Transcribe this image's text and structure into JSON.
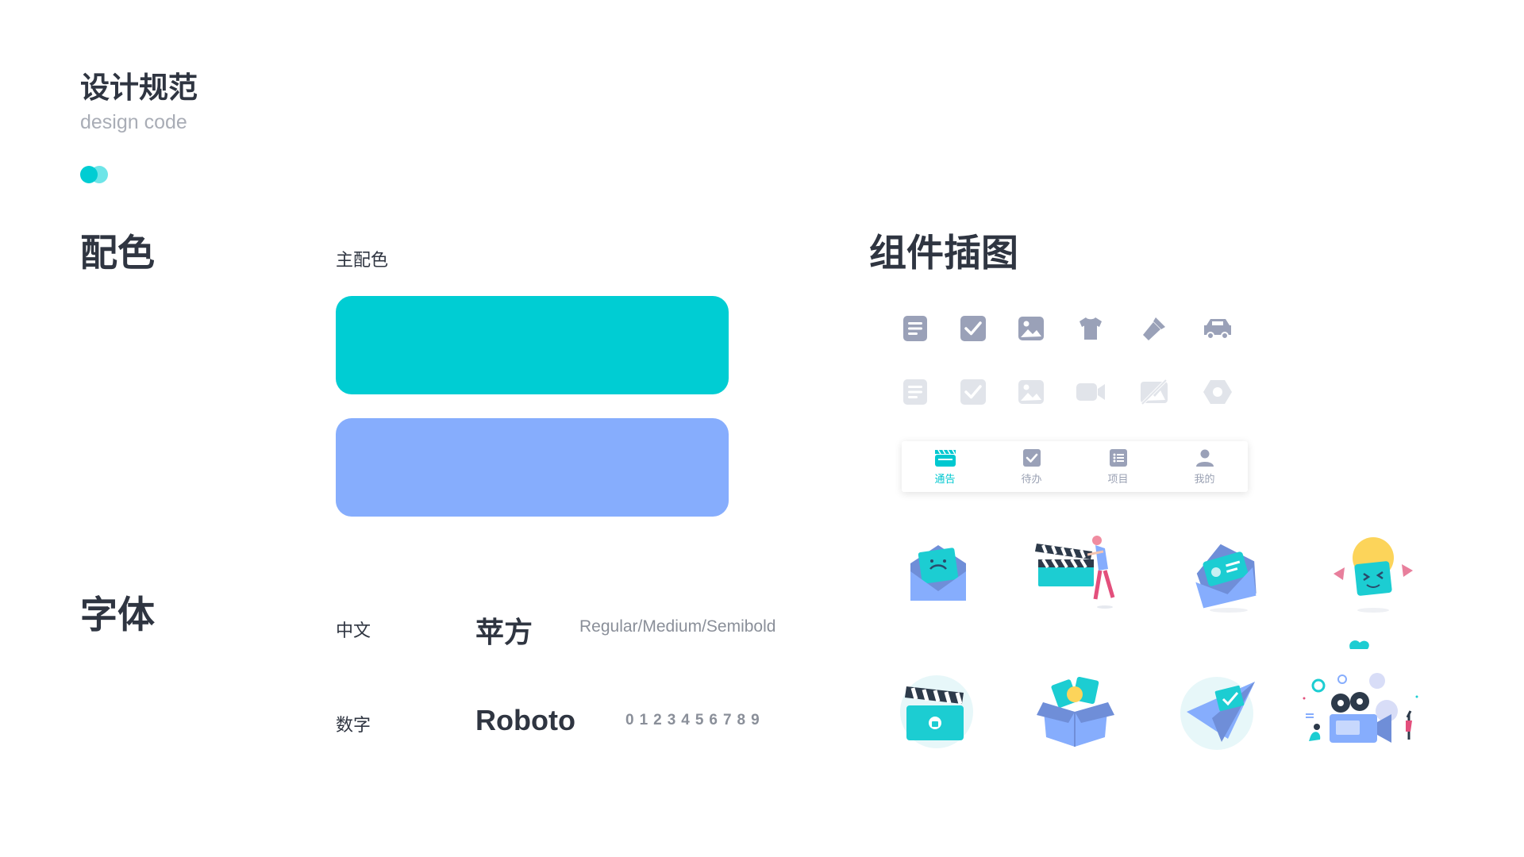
{
  "header": {
    "title": "设计规范",
    "subtitle": "design code"
  },
  "colors_section": {
    "heading": "配色",
    "primary_label": "主配色",
    "primary": "#00cdd3",
    "secondary": "#86adfd"
  },
  "fonts_section": {
    "heading": "字体",
    "chinese_label": "中文",
    "chinese_font": "苹方",
    "chinese_weights": "Regular/Medium/Semibold",
    "number_label": "数字",
    "number_font": "Roboto",
    "number_sample": "0123456789"
  },
  "illustrations_section": {
    "heading": "组件插图",
    "icon_row_active": [
      "document-icon",
      "checkbox-icon",
      "image-icon",
      "tshirt-icon",
      "flashlight-icon",
      "car-icon"
    ],
    "icon_row_disabled": [
      "document-icon",
      "checkbox-icon",
      "image-icon",
      "video-icon",
      "image-off-icon",
      "hexagon-icon"
    ],
    "tabbar": [
      {
        "label": "通告",
        "icon": "clapperboard-icon",
        "active": true
      },
      {
        "label": "待办",
        "icon": "checkbox-icon",
        "active": false
      },
      {
        "label": "项目",
        "icon": "list-icon",
        "active": false
      },
      {
        "label": "我的",
        "icon": "user-icon",
        "active": false
      }
    ],
    "icon_active_color": "#9aa1b8",
    "icon_disabled_color": "#e1e4ea",
    "tab_active_color": "#00c8d0"
  }
}
